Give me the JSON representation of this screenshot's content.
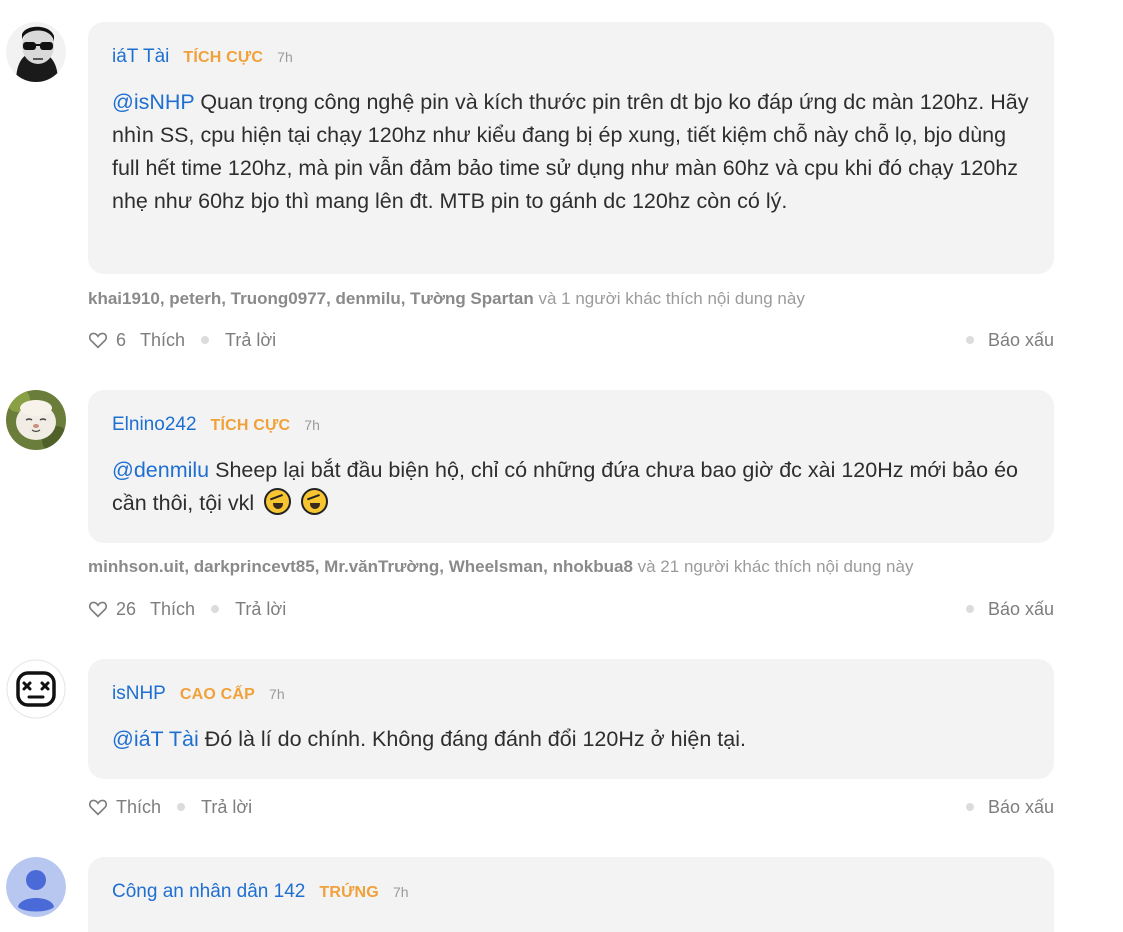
{
  "comments": [
    {
      "author": "iáT Tài",
      "rank": "TÍCH CỰC",
      "time": "7h",
      "mention": "@isNHP",
      "text": " Quan trọng công nghệ pin và kích thước pin trên dt bjo ko đáp ứng dc màn 120hz. Hãy nhìn SS, cpu hiện tại chạy 120hz như kiểu đang bị ép xung, tiết kiệm chỗ này chỗ lọ, bjo dùng full hết time 120hz, mà pin vẫn đảm bảo time sử dụng như màn 60hz và cpu khi đó chạy 120hz nhẹ như 60hz bjo thì mang lên đt. MTB pin to gánh dc 120hz còn có lý.",
      "likers_names": "khai1910, peterh, Truong0977, denmilu, Tường Spartan",
      "likers_suffix": " và 1 người khác thích nội dung này",
      "like_count": "6",
      "like_label": "Thích",
      "reply_label": "Trả lời",
      "report_label": "Báo xấu"
    },
    {
      "author": "Elnino242",
      "rank": "TÍCH CỰC",
      "time": "7h",
      "mention": "@denmilu",
      "text": " Sheep lại bắt đầu biện hộ, chỉ có những đứa chưa bao giờ đc xài 120Hz mới bảo éo cần thôi, tội vkl",
      "emojis": [
        "rofl-emoji",
        "rofl-emoji"
      ],
      "likers_names": "minhson.uit, darkprincevt85, Mr.vănTrường, Wheelsman, nhokbua8",
      "likers_suffix": " và 21 người khác thích nội dung này",
      "like_count": "26",
      "like_label": "Thích",
      "reply_label": "Trả lời",
      "report_label": "Báo xấu"
    },
    {
      "author": "isNHP",
      "rank": "CAO CẤP",
      "time": "7h",
      "mention": "@iáT Tài",
      "text": " Đó là lí do chính. Không đáng đánh đổi 120Hz ở hiện tại.",
      "like_label": "Thích",
      "reply_label": "Trả lời",
      "report_label": "Báo xấu"
    },
    {
      "author": "Công an nhân dân 142",
      "rank": "TRỨNG",
      "time": "7h"
    }
  ],
  "colors": {
    "author": "#1f6fd1",
    "rank": "#f0a13a",
    "bubble": "#f3f3f4"
  }
}
